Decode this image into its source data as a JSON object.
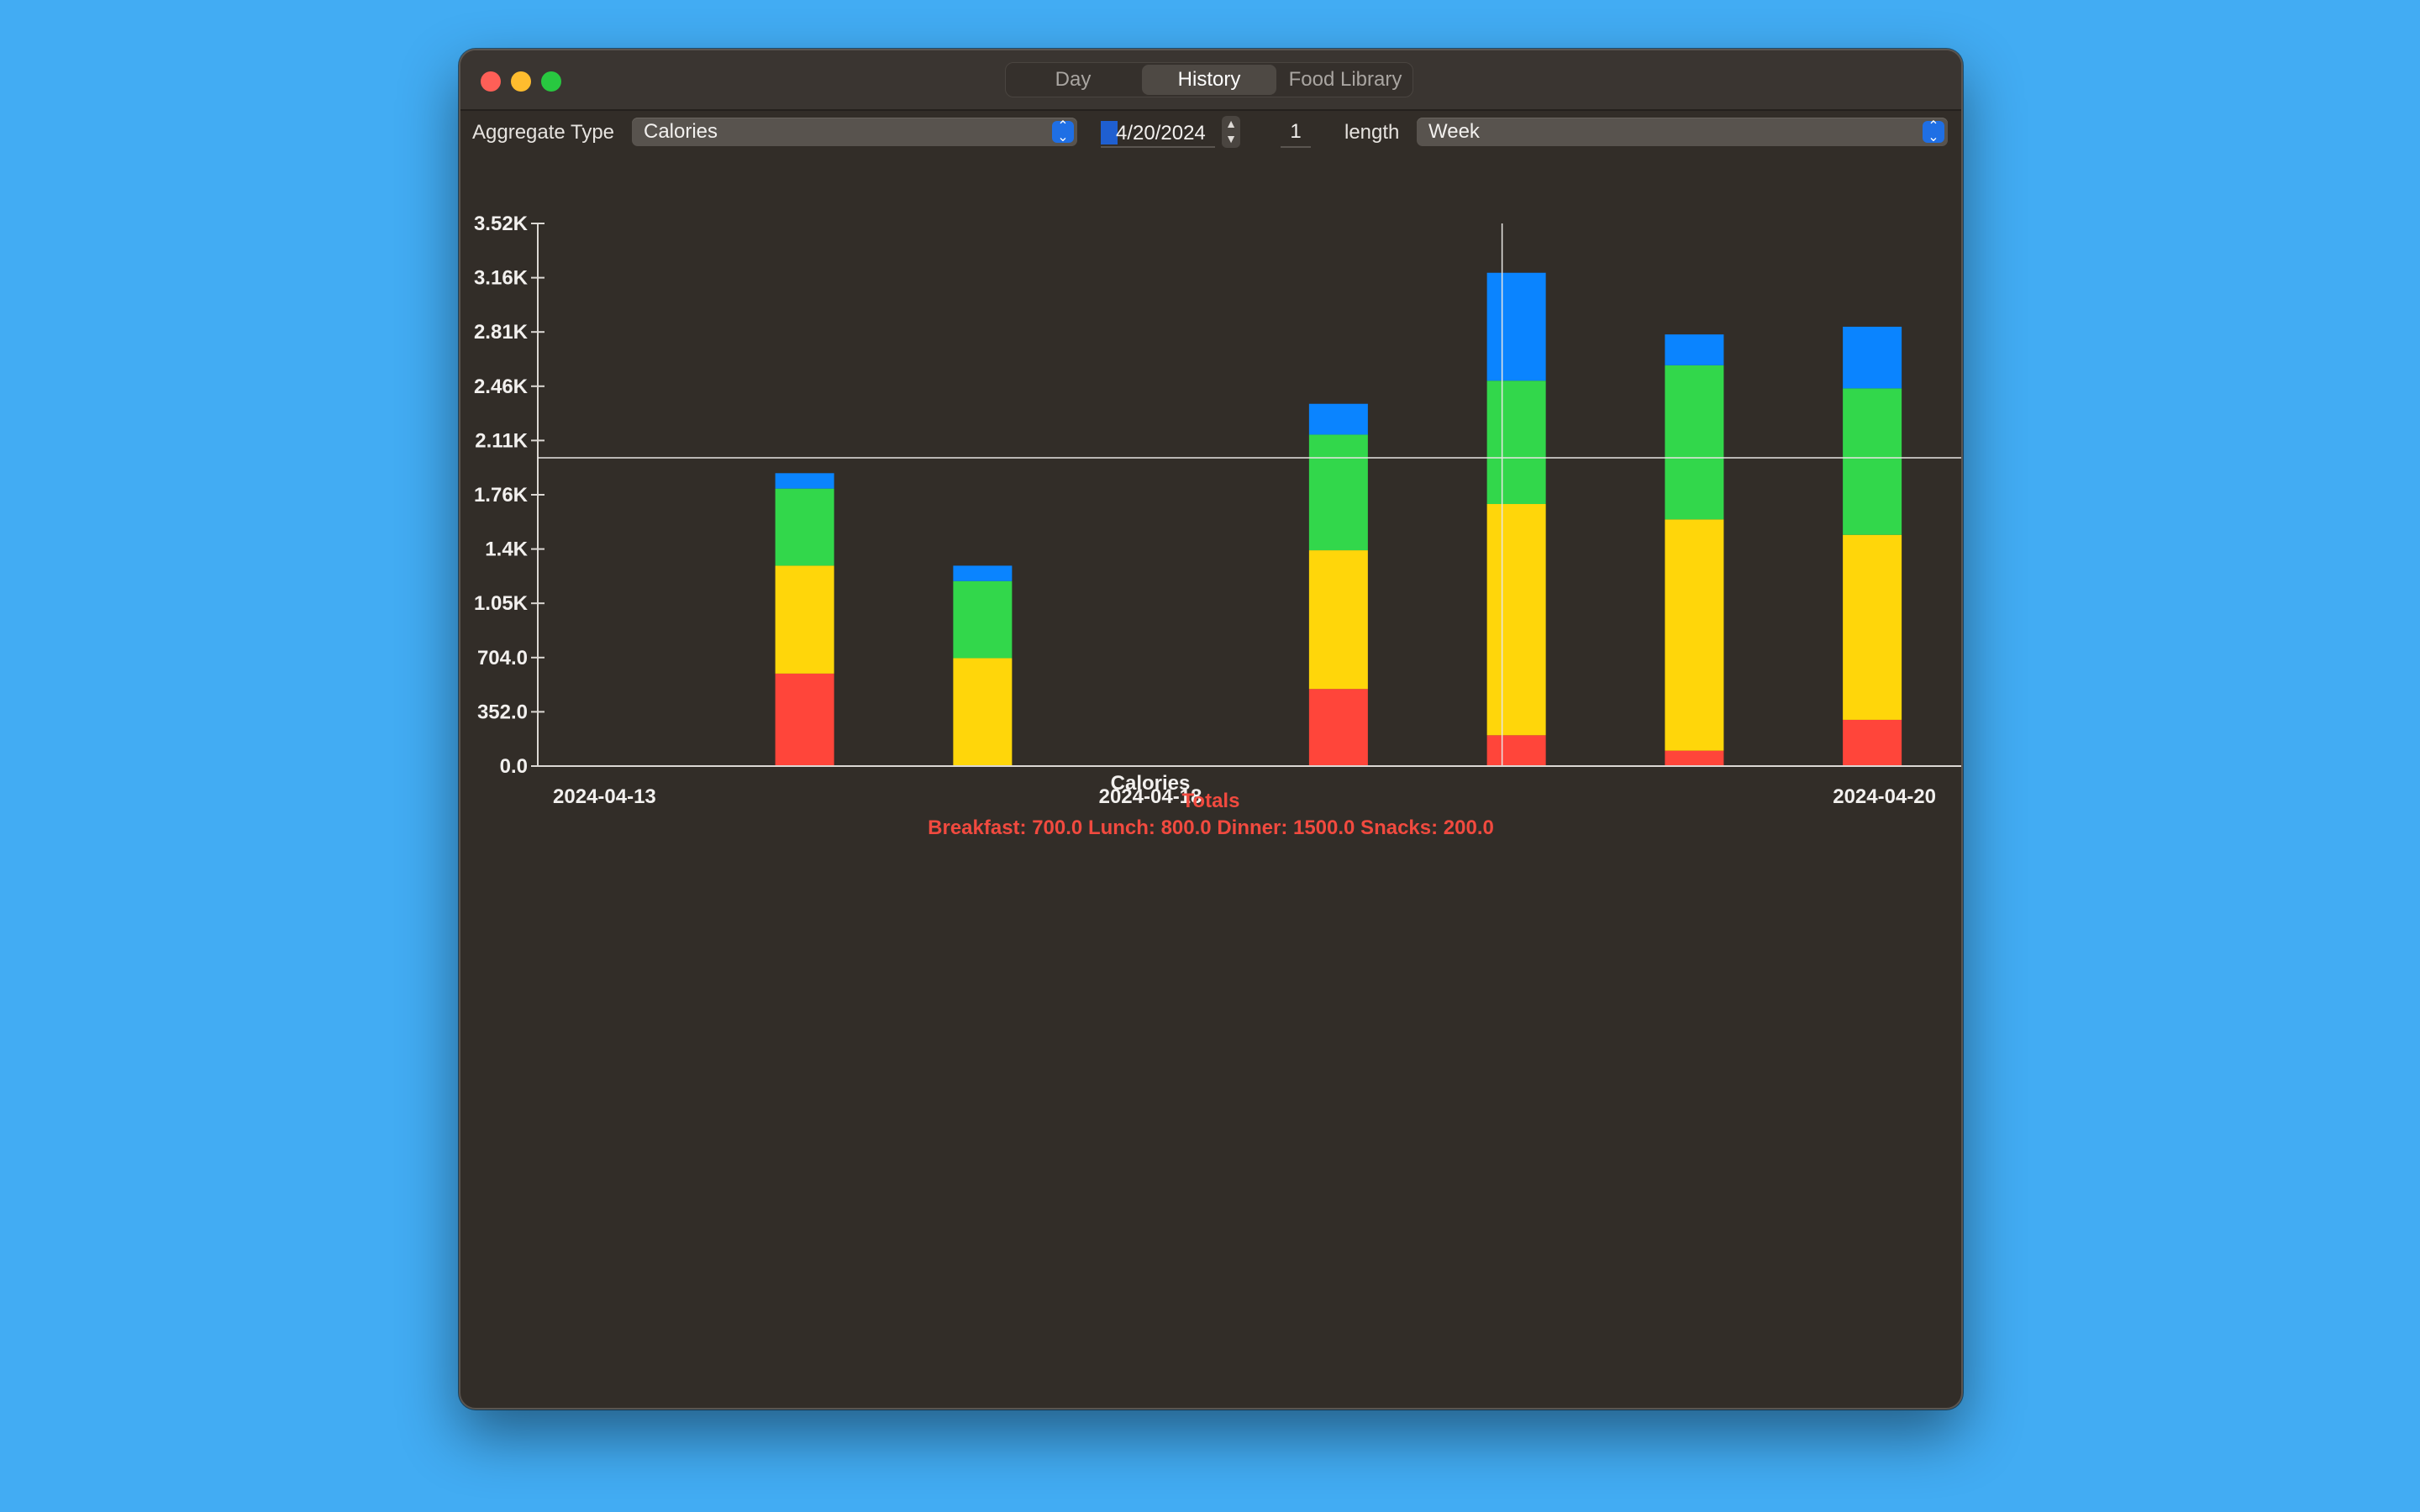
{
  "window": {
    "tabs": [
      {
        "label": "Day",
        "selected": false
      },
      {
        "label": "History",
        "selected": true
      },
      {
        "label": "Food Library",
        "selected": false
      }
    ]
  },
  "toolbar": {
    "aggregate_label": "Aggregate Type",
    "aggregate_value": "Calories",
    "date_value": "4/20/2024",
    "count_value": "1",
    "length_label": "length",
    "length_value": "Week"
  },
  "chart_data": {
    "type": "bar",
    "stacked": true,
    "title": "Calories",
    "ylim": [
      0,
      3520
    ],
    "y_ticks": [
      "0.0",
      "352.0",
      "704.0",
      "1.05K",
      "1.4K",
      "1.76K",
      "2.11K",
      "2.46K",
      "2.81K",
      "3.16K",
      "3.52K"
    ],
    "x_labels": [
      "2024-04-13",
      "2024-04-18",
      "2024-04-20"
    ],
    "reference_line": 2000,
    "cursor_day_index": 5,
    "days": 8,
    "colors": {
      "breakfast": "#ff453a",
      "lunch": "#ffd60a",
      "dinner": "#32d74b",
      "snacks": "#0a84ff"
    },
    "series": [
      {
        "key": "breakfast",
        "values": [
          0,
          600,
          0,
          0,
          500,
          200,
          100,
          300
        ]
      },
      {
        "key": "lunch",
        "values": [
          0,
          700,
          700,
          0,
          900,
          1500,
          1500,
          1200
        ]
      },
      {
        "key": "dinner",
        "values": [
          0,
          500,
          500,
          0,
          750,
          800,
          1000,
          950
        ]
      },
      {
        "key": "snacks",
        "values": [
          0,
          100,
          100,
          0,
          200,
          700,
          200,
          400
        ]
      }
    ]
  },
  "totals": {
    "title": "Totals",
    "summary": "Breakfast: 700.0 Lunch: 800.0 Dinner: 1500.0 Snacks: 200.0"
  }
}
